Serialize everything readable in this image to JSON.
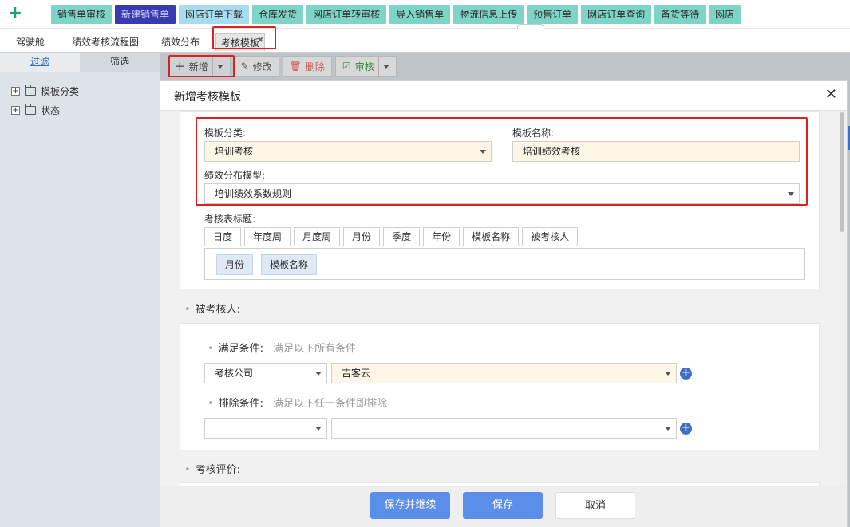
{
  "topbar": {
    "quick_buttons": [
      "销售单审核",
      "新建销售单",
      "网店订单下载",
      "仓库发货",
      "网店订单转审核",
      "导入销售单",
      "物流信息上传",
      "预售订单",
      "网店订单查询",
      "备货等待",
      "网店"
    ]
  },
  "tabs": [
    "驾驶舱",
    "绩效考核流程图",
    "绩效分布",
    "考核模板"
  ],
  "left_panel": {
    "tabs": [
      "过滤",
      "筛选"
    ],
    "tree": [
      "模板分类",
      "状态"
    ]
  },
  "toolbar": {
    "add_label": "新增",
    "edit_label": "修改",
    "delete_label": "删除",
    "audit_label": "审核"
  },
  "modal": {
    "title": "新增考核模板",
    "template_category_label": "模板分类:",
    "template_category_value": "培训考核",
    "template_name_label": "模板名称:",
    "template_name_value": "培训绩效考核",
    "distribution_label": "绩效分布模型:",
    "distribution_value": "培训绩效系数规则",
    "table_title_label": "考核表标题:",
    "title_tokens": [
      "日度",
      "年度周",
      "月度周",
      "月份",
      "季度",
      "年份",
      "模板名称",
      "被考核人"
    ],
    "selected_tokens": [
      "月份",
      "模板名称"
    ],
    "assessee_section": "被考核人:",
    "match_label": "满足条件:",
    "match_hint": "满足以下所有条件",
    "match_field": "考核公司",
    "match_value": "吉客云",
    "exclude_label": "排除条件:",
    "exclude_hint": "满足以下任一条件即排除",
    "evaluation_section": "考核评价:",
    "save_continue": "保存并继续",
    "save": "保存",
    "cancel": "取消"
  }
}
